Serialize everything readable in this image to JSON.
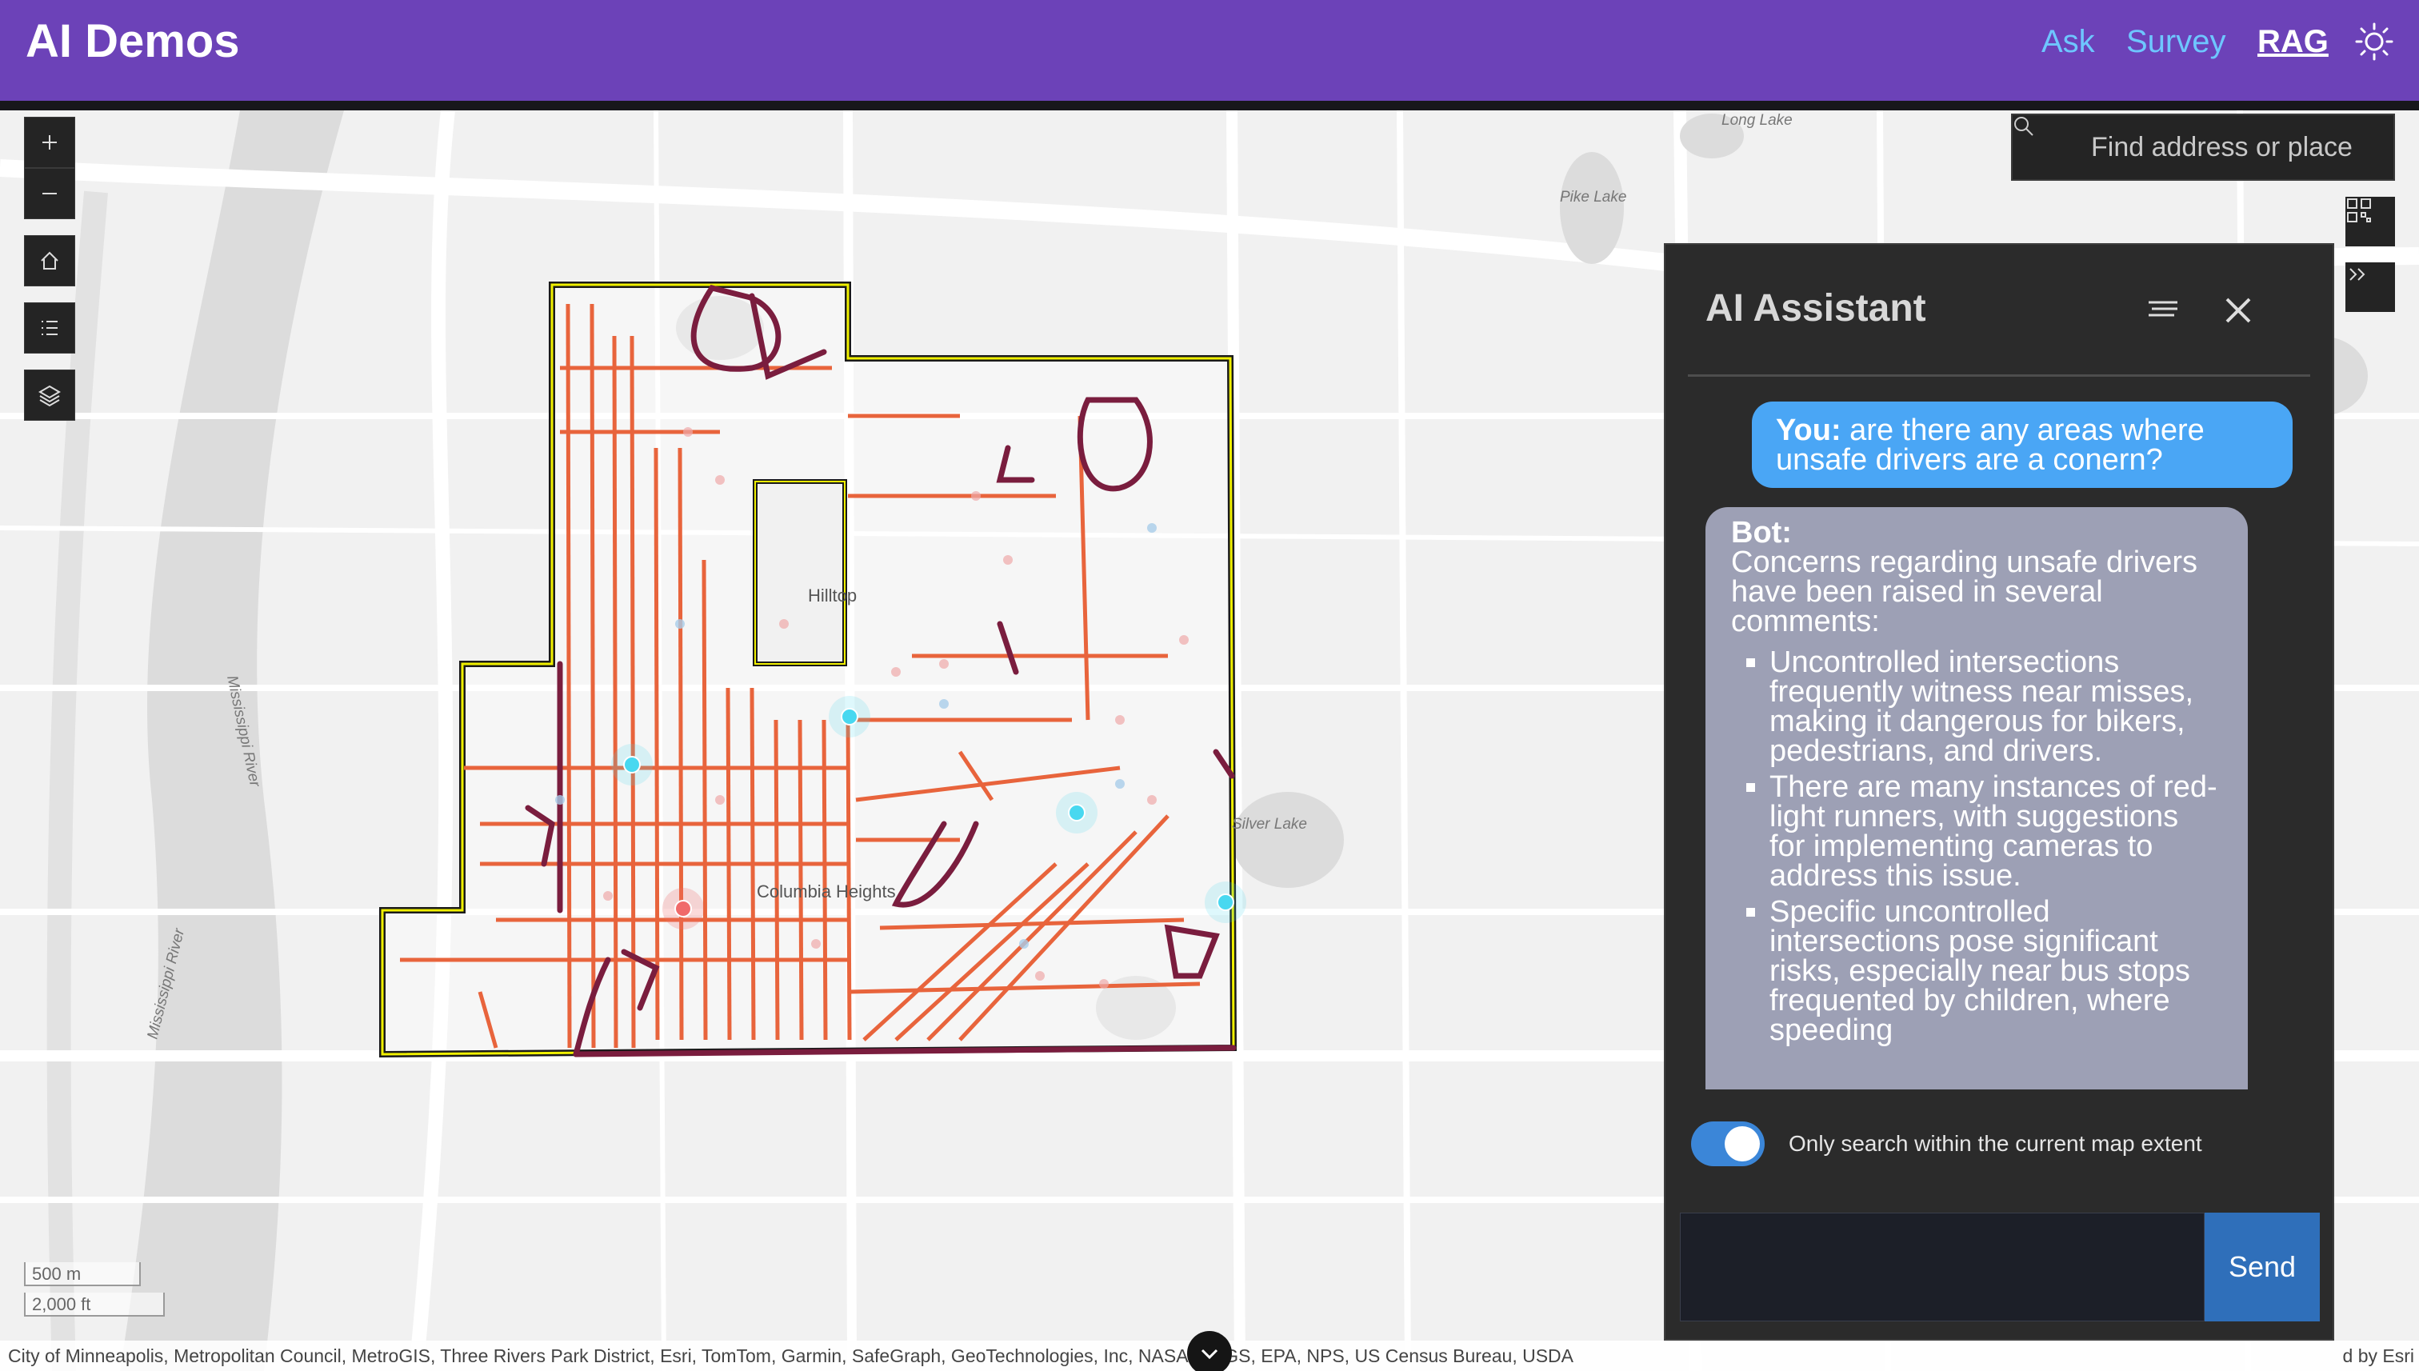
{
  "header": {
    "title": "AI Demos",
    "nav": [
      "Ask",
      "Survey",
      "RAG"
    ],
    "active_nav": "RAG",
    "theme_icon": "sun-icon"
  },
  "colors": {
    "header": "#6c42b8",
    "nav_link": "#6ec6ff",
    "user_bubble": "#4aa6f5",
    "bot_bubble": "#9da0b5",
    "panel": "#2b2b2b",
    "toggle_on": "#3b86d8",
    "send": "#2f6fba",
    "road": "#e8643c",
    "path": "#7a1d3e",
    "boundary": "#f0f000",
    "highlight_point": "#48d8f0"
  },
  "map": {
    "search_placeholder": "Find address or place",
    "labels": [
      "Long Lake",
      "Pike Lake",
      "Hilltop",
      "Columbia Heights",
      "Silver Lake",
      "Mississippi River",
      "Mississippi River"
    ],
    "scale": [
      "500 m",
      "2,000 ft"
    ],
    "attribution": "City of Minneapolis, Metropolitan Council, MetroGIS, Three Rivers Park District, Esri, TomTom, Garmin, SafeGraph, GeoTechnologies, Inc, NASA, USGS, EPA, NPS, US Census Bureau, USDA",
    "attribution_right": "d by Esri"
  },
  "assistant": {
    "title": "AI Assistant",
    "user_prefix": "You:",
    "user_message": "are there any areas where unsafe drivers are a conern?",
    "bot_prefix": "Bot:",
    "bot_intro": "Concerns regarding unsafe drivers have been raised in several comments:",
    "bot_points": [
      "Uncontrolled intersections frequently witness near misses, making it dangerous for bikers, pedestrians, and drivers.",
      "There are many instances of red-light runners, with suggestions for implementing cameras to address this issue.",
      "Specific uncontrolled intersections pose significant risks, especially near bus stops frequented by children, where speeding"
    ],
    "toggle_label": "Only search within the current map extent",
    "toggle_on": true,
    "send_label": "Send"
  }
}
